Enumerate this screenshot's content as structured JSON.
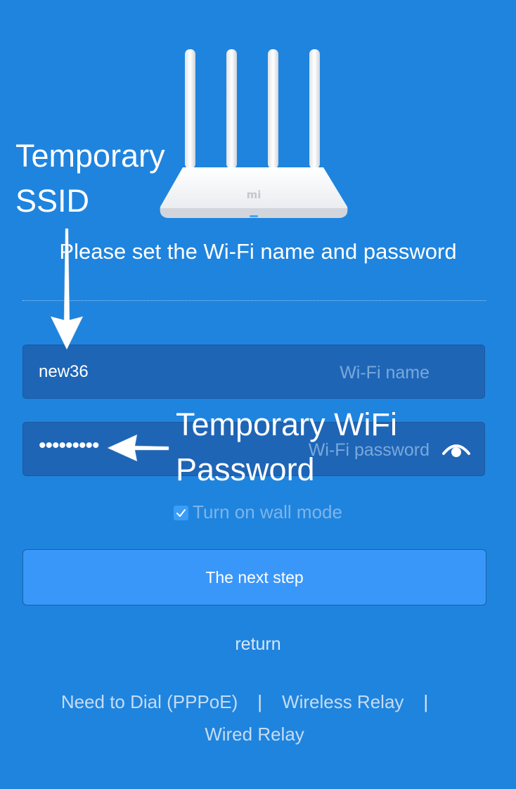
{
  "heading": "Please set the Wi-Fi name and password",
  "ssid_field": {
    "value": "new36",
    "placeholder": "Wi-Fi name"
  },
  "password_field": {
    "value": "•••••••••",
    "placeholder": "Wi-Fi password",
    "toggle_icon": "eye-icon"
  },
  "wall_mode": {
    "label": "Turn on wall mode",
    "checked": true
  },
  "next_button_label": "The next step",
  "return_label": "return",
  "mode_links": {
    "pppoe": "Need to Dial (PPPoE)",
    "separator": "|",
    "wireless_relay": "Wireless Relay",
    "wired_relay": "Wired Relay"
  },
  "annotations": {
    "ssid_line1": "Temporary",
    "ssid_line2": "SSID",
    "password_line1": "Temporary WiFi",
    "password_line2": "Password"
  },
  "router_logo": "mi",
  "colors": {
    "background": "#1f84de",
    "input_background": "#1f65b6",
    "button": "#3a97fa"
  }
}
